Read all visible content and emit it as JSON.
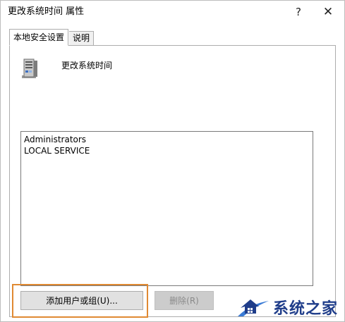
{
  "window": {
    "title": "更改系统时间 属性",
    "help_label": "?",
    "close_label": "✕"
  },
  "tabs": [
    {
      "label": "本地安全设置",
      "active": true
    },
    {
      "label": "说明",
      "active": false
    }
  ],
  "policy": {
    "name": "更改系统时间",
    "icon": "server-icon"
  },
  "accounts": [
    "Administrators",
    "LOCAL SERVICE"
  ],
  "buttons": {
    "add_label": "添加用户或组(U)...",
    "remove_label": "删除(R)"
  },
  "watermark": {
    "text": "系统之家",
    "color": "#1f3d8a"
  },
  "colors": {
    "highlight": "#e08a33"
  }
}
